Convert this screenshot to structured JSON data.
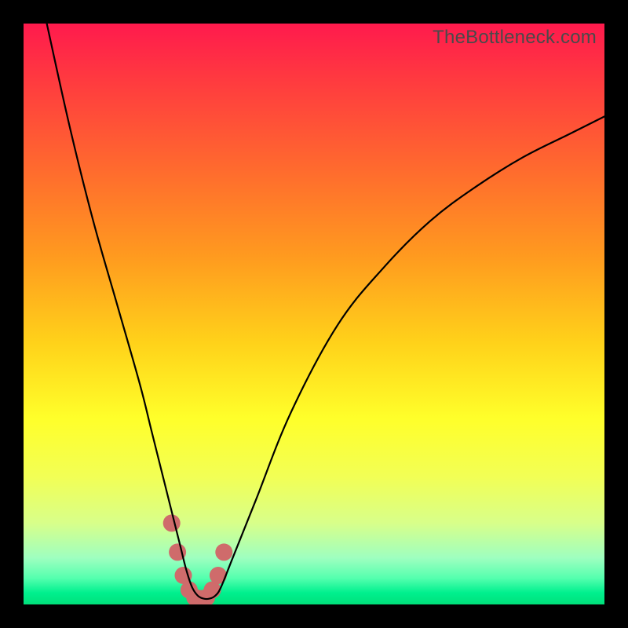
{
  "watermark": {
    "text": "TheBottleneck.com"
  },
  "colors": {
    "frame": "#000000",
    "curve_stroke": "#000000",
    "marker_fill": "#cf6b6b",
    "gradient_stops": [
      {
        "offset": 0.0,
        "color": "#ff1a4d"
      },
      {
        "offset": 0.1,
        "color": "#ff3b3f"
      },
      {
        "offset": 0.25,
        "color": "#ff6a2e"
      },
      {
        "offset": 0.4,
        "color": "#ff9a1f"
      },
      {
        "offset": 0.55,
        "color": "#ffd21a"
      },
      {
        "offset": 0.68,
        "color": "#ffff2a"
      },
      {
        "offset": 0.78,
        "color": "#f2ff55"
      },
      {
        "offset": 0.86,
        "color": "#d8ff8a"
      },
      {
        "offset": 0.92,
        "color": "#9effc0"
      },
      {
        "offset": 0.955,
        "color": "#54ffae"
      },
      {
        "offset": 0.98,
        "color": "#00f08e"
      },
      {
        "offset": 1.0,
        "color": "#00e07a"
      }
    ]
  },
  "chart_data": {
    "type": "line",
    "title": "",
    "xlabel": "",
    "ylabel": "",
    "xlim": [
      0,
      100
    ],
    "ylim": [
      0,
      100
    ],
    "series": [
      {
        "name": "bottleneck-curve",
        "x": [
          4,
          8,
          12,
          16,
          20,
          22,
          24,
          26,
          27,
          28,
          29,
          30,
          31,
          32,
          33,
          34,
          36,
          40,
          46,
          54,
          62,
          70,
          78,
          86,
          94,
          100
        ],
        "values": [
          100,
          82,
          66,
          52,
          38,
          30,
          22,
          14,
          10,
          6,
          3,
          1.5,
          1,
          1,
          1.5,
          3,
          8,
          18,
          33,
          48,
          58,
          66,
          72,
          77,
          81,
          84
        ]
      }
    ],
    "markers": {
      "name": "highlight-segment",
      "x": [
        25.5,
        26.5,
        27.5,
        28.5,
        29.5,
        30.5,
        31.5,
        32.5,
        33.5,
        34.5
      ],
      "values": [
        14,
        9,
        5,
        2.5,
        1.2,
        1,
        1.2,
        2.5,
        5,
        9
      ],
      "radius_px": 11
    }
  }
}
